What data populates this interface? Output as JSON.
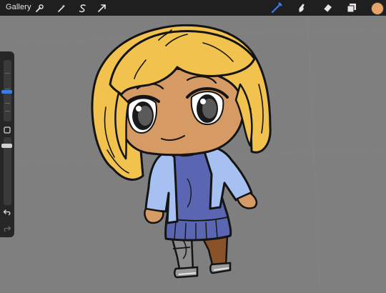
{
  "topbar": {
    "gallery_label": "Gallery",
    "left_tools": [
      "wrench-icon",
      "magic-wand-icon",
      "selection-s-icon",
      "transform-arrow-icon"
    ],
    "right_tools": [
      "brush-icon",
      "smudge-icon",
      "eraser-icon",
      "layers-icon"
    ],
    "active_tool": "brush-icon",
    "active_tool_color": "#3e7de2",
    "current_color": "#e8a468"
  },
  "sidebar": {
    "brush_size": 0.48,
    "opacity": 1.0,
    "icons": [
      "modify-square-icon",
      "undo-icon",
      "redo-icon"
    ]
  },
  "canvas": {
    "background": "#7f7f7f",
    "subject": "chibi-girl-illustration",
    "palette": {
      "hair": "#f2c24e",
      "skin": "#d69a64",
      "cardigan": "#a6c0f2",
      "dress": "#5b66b3",
      "leg_left": "#8c8c8c",
      "leg_right": "#8a5228",
      "shoes": "#9a9a9a",
      "outline": "#141414"
    }
  }
}
